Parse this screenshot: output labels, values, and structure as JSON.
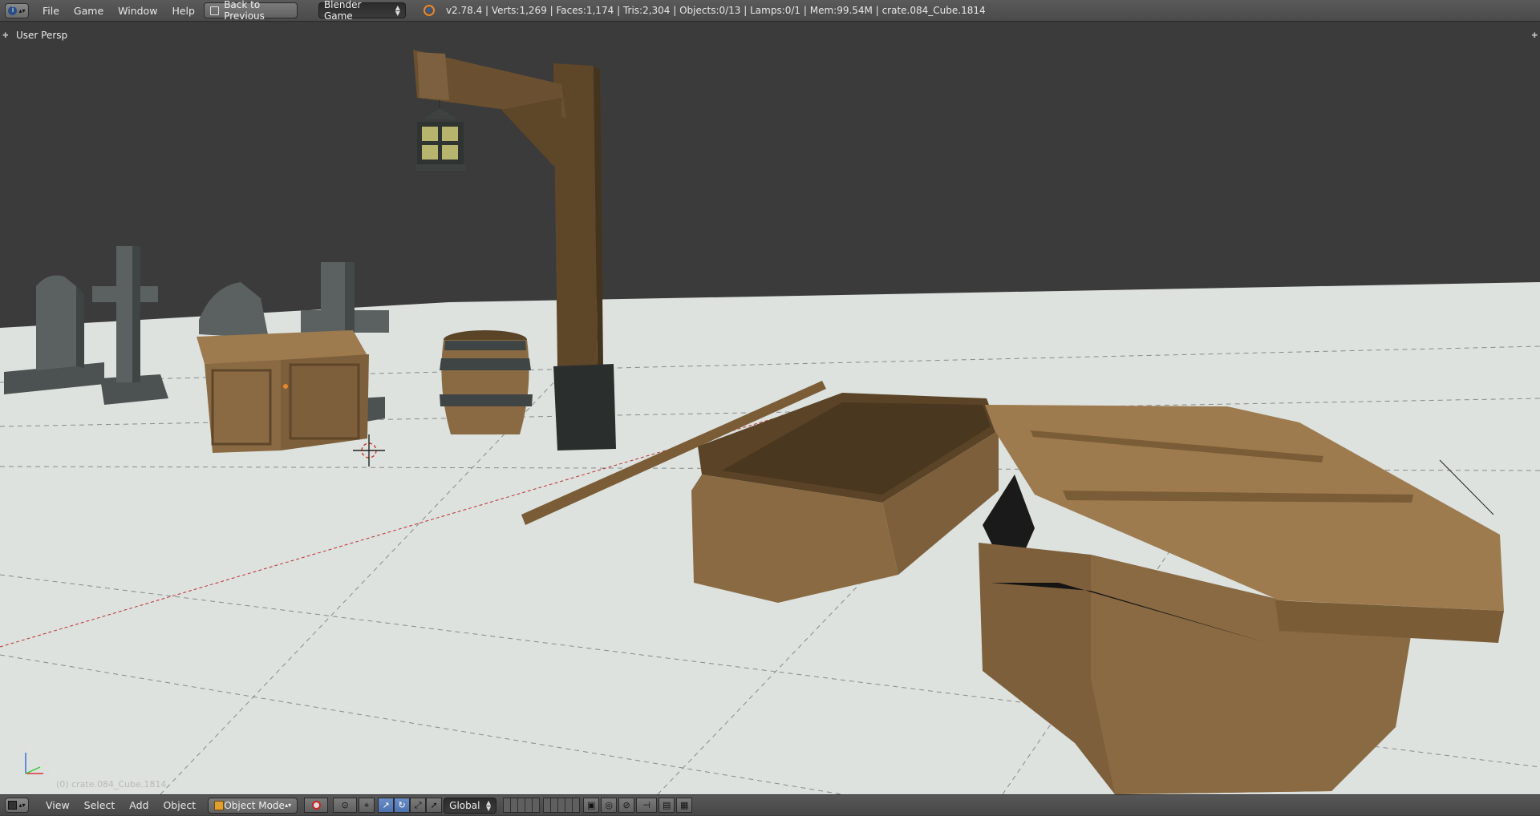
{
  "info_header": {
    "editor_type_icon": "info-icon",
    "menus": [
      "File",
      "Game",
      "Window",
      "Help"
    ],
    "back_button": "Back to Previous",
    "engine_dropdown": "Blender Game",
    "blender_logo_icon": "blender-logo-icon",
    "stats": "v2.78.4 | Verts:1,269 | Faces:1,174 | Tris:2,304 | Objects:0/13 | Lamps:0/1 | Mem:99.54M | crate.084_Cube.1814"
  },
  "viewport": {
    "view_label": "User Persp",
    "active_object_label": "(0) crate.084_Cube.1814",
    "axis_labels": {
      "x": "X",
      "y": "Y",
      "z": "Z"
    },
    "colors": {
      "background": "#3b3b3b",
      "ground": "#dde2df",
      "wood": "#8a6a43",
      "wood_dark": "#5e4629",
      "stone": "#5b6160",
      "lantern_glass": "#b7b46e"
    }
  },
  "view3d_header": {
    "menus": [
      "View",
      "Select",
      "Add",
      "Object"
    ],
    "mode_dropdown": "Object Mode",
    "orientation_dropdown": "Global"
  }
}
